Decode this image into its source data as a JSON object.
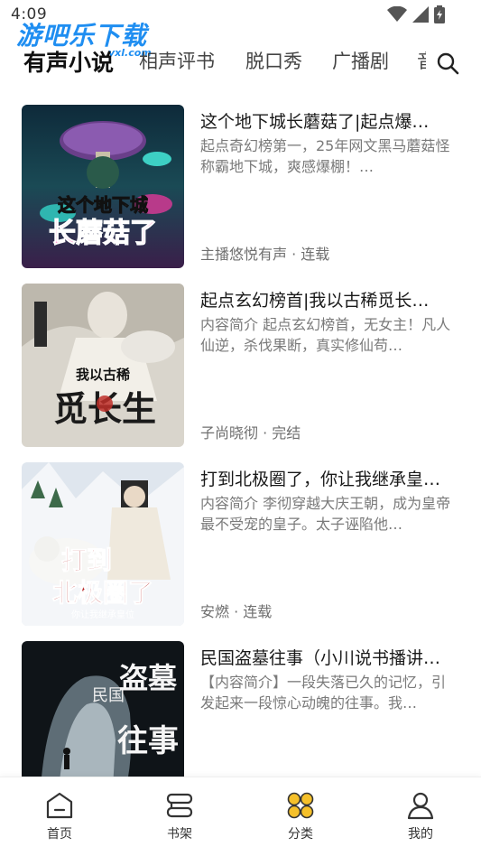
{
  "status_bar": {
    "time": "4:09",
    "icons": [
      "wifi-icon",
      "signal-icon",
      "battery-icon"
    ]
  },
  "watermark": {
    "text": "游吧乐下载",
    "sub": "yxl.com"
  },
  "tabs": [
    {
      "label": "有声小说",
      "active": true
    },
    {
      "label": "相声评书",
      "active": false
    },
    {
      "label": "脱口秀",
      "active": false
    },
    {
      "label": "广播剧",
      "active": false
    },
    {
      "label": "音",
      "active": false
    }
  ],
  "books": [
    {
      "title": "这个地下城长蘑菇了|起点爆…",
      "description": "起点奇幻榜第一，25年网文黑马蘑菇怪称霸地下城，爽感爆棚！…",
      "meta": "主播悠悦有声 · 连载",
      "cover_text": [
        "这个地下城",
        "长蘑菇了"
      ]
    },
    {
      "title": "起点玄幻榜首|我以古稀觅长…",
      "description": "内容简介 起点玄幻榜首，无女主！凡人仙逆，杀伐果断，真实修仙苟…",
      "meta": "子尚晓彻 · 完结",
      "cover_text": [
        "我以古稀",
        "觅长生"
      ]
    },
    {
      "title": "打到北极圈了，你让我继承皇…",
      "description": "内容简介 李彻穿越大庆王朝，成为皇帝最不受宠的皇子。太子诬陷他…",
      "meta": "安燃 · 连载",
      "cover_text": [
        "打到",
        "北极圈了",
        "你让我继承皇位"
      ]
    },
    {
      "title": "民国盗墓往事（小川说书播讲…",
      "description": "【内容简介】一段失落已久的记忆，引发起来一段惊心动魄的往事。我…",
      "meta": "",
      "cover_text": [
        "民国",
        "盗墓",
        "往事"
      ]
    }
  ],
  "bottom_nav": [
    {
      "label": "首页",
      "icon": "home-icon"
    },
    {
      "label": "书架",
      "icon": "bookshelf-icon"
    },
    {
      "label": "分类",
      "icon": "category-icon",
      "accent": "#f5c02a"
    },
    {
      "label": "我的",
      "icon": "user-icon"
    }
  ]
}
